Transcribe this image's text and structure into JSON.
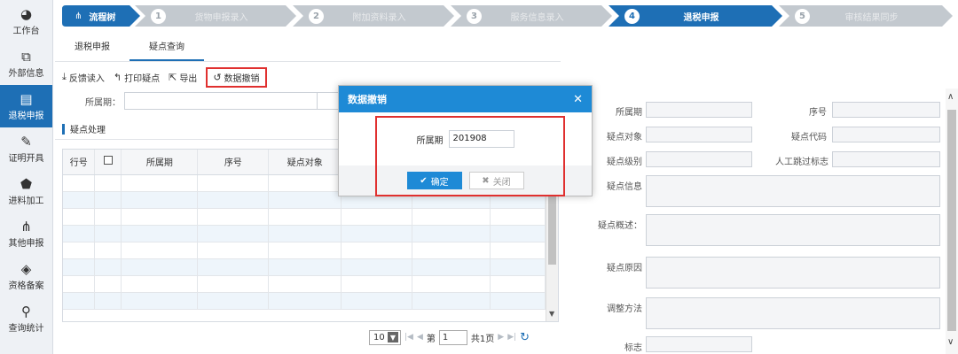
{
  "sidebar": {
    "items": [
      {
        "label": "工作台",
        "icon": "dashboard-icon",
        "glyph": "◕"
      },
      {
        "label": "外部信息",
        "icon": "external-icon",
        "glyph": "⧉"
      },
      {
        "label": "退税申报",
        "icon": "document-icon",
        "glyph": "▤"
      },
      {
        "label": "证明开具",
        "icon": "edit-icon",
        "glyph": "✎"
      },
      {
        "label": "进料加工",
        "icon": "shield-icon",
        "glyph": "⬟"
      },
      {
        "label": "其他申报",
        "icon": "sitemap-icon",
        "glyph": "⋔"
      },
      {
        "label": "资格备案",
        "icon": "cube-icon",
        "glyph": "◈"
      },
      {
        "label": "查询统计",
        "icon": "search-icon",
        "glyph": "⚲"
      }
    ]
  },
  "wizard": {
    "start_label": "流程树",
    "steps": [
      {
        "num": "1",
        "label": "货物申报录入"
      },
      {
        "num": "2",
        "label": "附加资料录入"
      },
      {
        "num": "3",
        "label": "服务信息录入"
      },
      {
        "num": "4",
        "label": "退税申报"
      },
      {
        "num": "5",
        "label": "审核结果同步"
      }
    ]
  },
  "tabs": [
    "退税申报",
    "疑点查询"
  ],
  "toolbar": {
    "feedback": "反馈读入",
    "print": "打印疑点",
    "export": "导出",
    "revoke": "数据撤销"
  },
  "filter": {
    "period_label": "所属期："
  },
  "section": {
    "title": "疑点处理"
  },
  "table": {
    "headers": [
      "行号",
      "",
      "所属期",
      "序号",
      "疑点对象"
    ]
  },
  "pager": {
    "page_size": "10",
    "page_prefix": "第",
    "page_value": "1",
    "total": "共1页"
  },
  "form": {
    "period": "所属期",
    "seq": "序号",
    "object": "疑点对象",
    "code": "疑点代码",
    "level": "疑点级别",
    "manual": "人工跳过标志",
    "info": "疑点信息",
    "summary": "疑点概述：",
    "reason": "疑点原因",
    "method": "调整方法",
    "flag": "标志"
  },
  "modal": {
    "title": "数据撤销",
    "field_label": "所属期",
    "field_value": "201908",
    "ok": "确定",
    "cancel": "关闭"
  },
  "colors": {
    "accent": "#1e6fb5",
    "modal_header": "#1e8ad6",
    "highlight": "#e0302f"
  }
}
